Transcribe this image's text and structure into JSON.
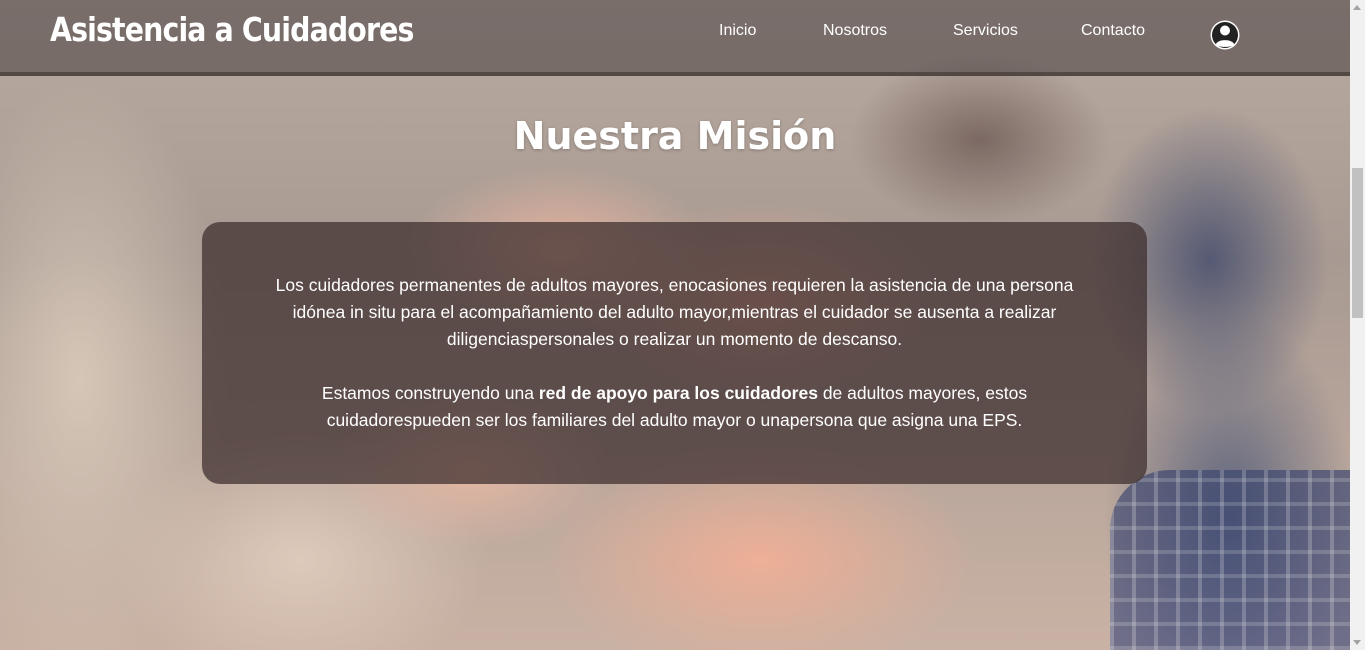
{
  "header": {
    "brand": "Asistencia a Cuidadores",
    "nav": [
      {
        "label": "Inicio"
      },
      {
        "label": "Nosotros"
      },
      {
        "label": "Servicios"
      },
      {
        "label": "Contacto"
      }
    ],
    "user_icon": "user-circle-icon"
  },
  "mission": {
    "title": "Nuestra Misión",
    "paragraph1": "Los cuidadores permanentes de adultos mayores, enocasiones requieren la asistencia de una persona idónea in situ para el acompañamiento del adulto mayor,mientras el cuidador se ausenta a realizar diligenciaspersonales o realizar un momento de descanso.",
    "paragraph2_before": "Estamos construyendo una ",
    "paragraph2_bold": "red de apoyo para los cuidadores",
    "paragraph2_after": " de adultos mayores, estos cuidadorespueden ser los familiares del adulto mayor o unapersona que asigna una EPS."
  },
  "colors": {
    "navbar_bg": "#463e3e",
    "card_bg": "#3c2d2d",
    "text": "#ffffff",
    "scrollbar_track": "#f1f1f1",
    "scrollbar_thumb": "#c1c1c1"
  }
}
